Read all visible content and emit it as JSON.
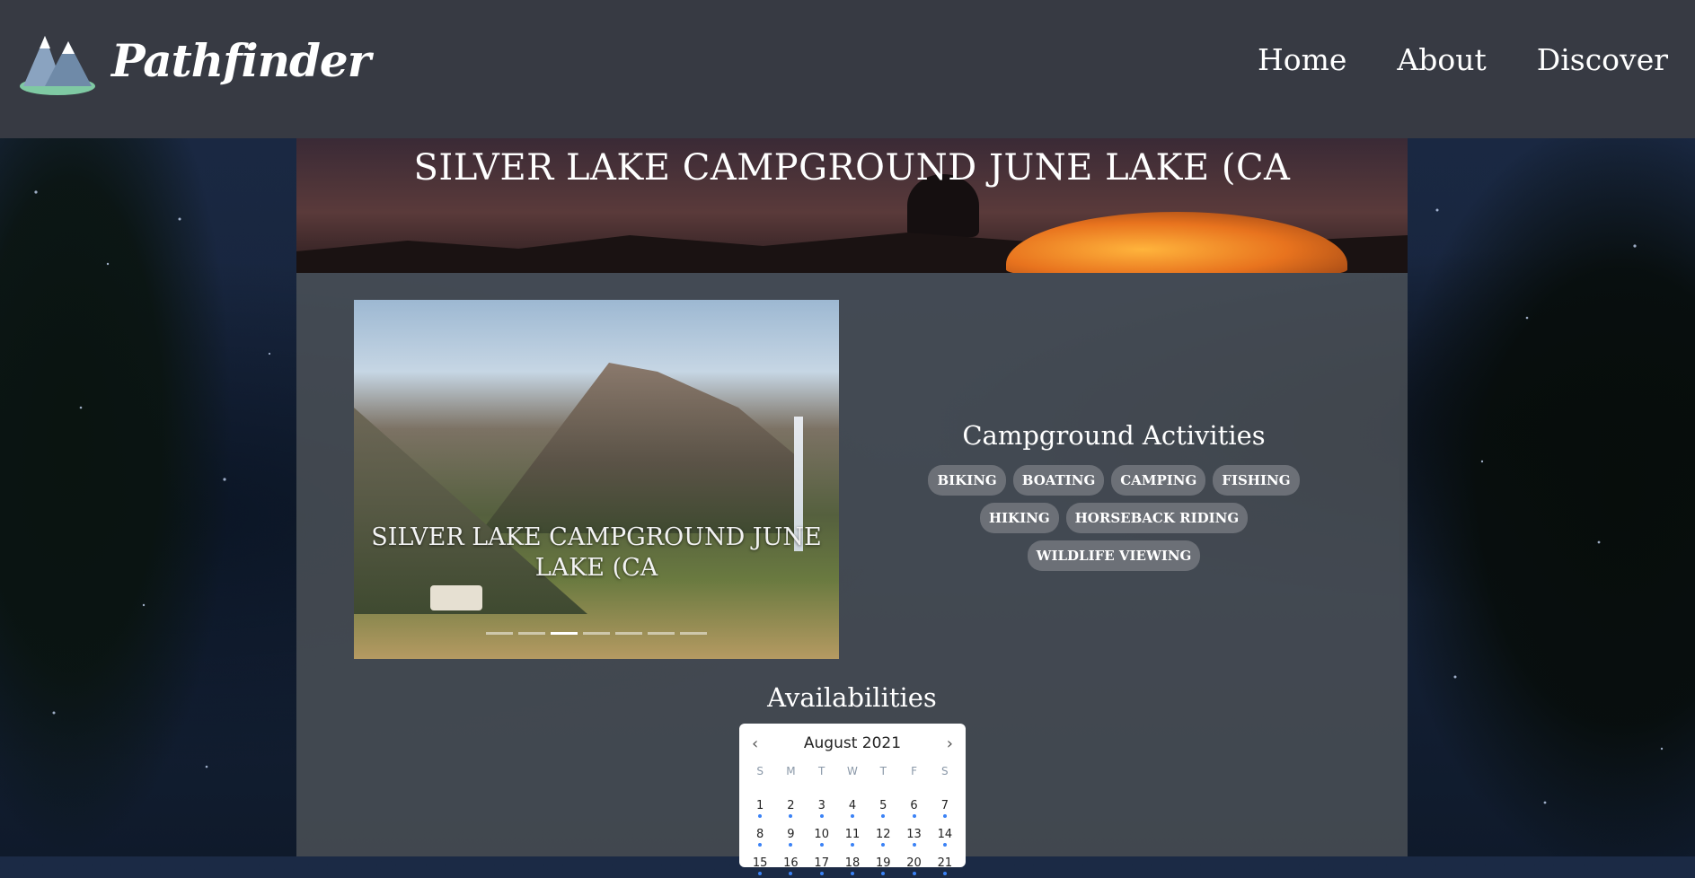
{
  "brand": {
    "name": "Pathfinder",
    "logo_icon": "mountain-logo-icon"
  },
  "nav": {
    "items": [
      "Home",
      "About",
      "Discover"
    ]
  },
  "banner": {
    "title": "SILVER LAKE CAMPGROUND JUNE LAKE (CA"
  },
  "carousel": {
    "caption": "SILVER LAKE CAMPGROUND JUNE LAKE (CA",
    "slide_count": 7,
    "active_slide": 3
  },
  "activities": {
    "heading": "Campground Activities",
    "tags": [
      "BIKING",
      "BOATING",
      "CAMPING",
      "FISHING",
      "HIKING",
      "HORSEBACK RIDING",
      "WILDLIFE VIEWING"
    ]
  },
  "availabilities": {
    "heading": "Availabilities",
    "calendar": {
      "month_label": "August 2021",
      "prev_icon": "chevron-left-icon",
      "next_icon": "chevron-right-icon",
      "weekdays": [
        "S",
        "M",
        "T",
        "W",
        "T",
        "F",
        "S"
      ],
      "days": [
        "1",
        "2",
        "3",
        "4",
        "5",
        "6",
        "7",
        "8",
        "9",
        "10",
        "11",
        "12",
        "13",
        "14",
        "15",
        "16",
        "17",
        "18",
        "19",
        "20",
        "21"
      ]
    }
  },
  "colors": {
    "header_bg": "#373a43",
    "panel_bg": "#50545a",
    "tag_bg": "#6c7077",
    "availability_dot": "#3b82f6"
  }
}
